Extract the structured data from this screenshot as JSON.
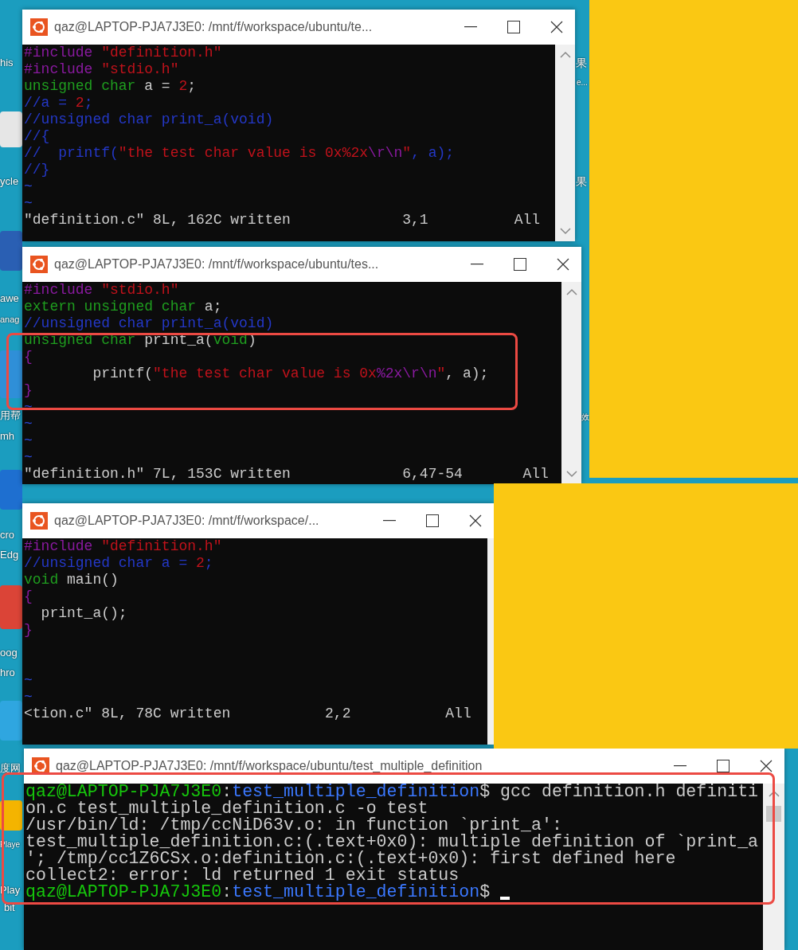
{
  "desktop": {
    "icon_labels": [
      {
        "text": "his"
      },
      {
        "text": "ycle"
      },
      {
        "text": "awe"
      },
      {
        "text": "anag"
      },
      {
        "text": "用帮"
      },
      {
        "text": "mh"
      },
      {
        "text": "cro"
      },
      {
        "text": "Edg"
      },
      {
        "text": "oog"
      },
      {
        "text": "hro"
      },
      {
        "text": "度网"
      },
      {
        "text": "Playe"
      },
      {
        "text": "Play"
      },
      {
        "text": "bit"
      },
      {
        "text": "果"
      },
      {
        "text": "e..."
      },
      {
        "text": "果"
      },
      {
        "text": "效"
      }
    ]
  },
  "windows": [
    {
      "kind": "vim",
      "title": "qaz@LAPTOP-PJA7J3E0: /mnt/f/workspace/ubuntu/te...",
      "lines": [
        [
          {
            "kind": "preproc",
            "text": "#include "
          },
          {
            "kind": "string",
            "text": "\"definition.h\""
          }
        ],
        [
          {
            "kind": "preproc",
            "text": "#include "
          },
          {
            "kind": "string",
            "text": "\"stdio.h\""
          }
        ],
        [
          {
            "kind": "type",
            "text": "unsigned char"
          },
          {
            "kind": "plain",
            "text": " a = "
          },
          {
            "kind": "number",
            "text": "2"
          },
          {
            "kind": "plain",
            "text": ";"
          }
        ],
        [
          {
            "kind": "comment",
            "text": "//a = "
          },
          {
            "kind": "number",
            "text": "2"
          },
          {
            "kind": "comment",
            "text": ";"
          }
        ],
        [
          {
            "kind": "comment",
            "text": "//unsigned char print_a(void)"
          }
        ],
        [
          {
            "kind": "comment",
            "text": "//{"
          }
        ],
        [
          {
            "kind": "comment",
            "text": "//  printf("
          },
          {
            "kind": "string",
            "text": "\"the test char value is 0x%2x"
          },
          {
            "kind": "special",
            "text": "\\r\\n"
          },
          {
            "kind": "string",
            "text": "\""
          },
          {
            "kind": "comment",
            "text": ", a);"
          }
        ],
        [
          {
            "kind": "comment",
            "text": "//}"
          }
        ],
        [
          {
            "kind": "tilde",
            "text": "~"
          }
        ],
        [
          {
            "kind": "tilde",
            "text": "~"
          }
        ]
      ],
      "status": {
        "message": "\"definition.c\" 8L, 162C written",
        "ruler": "3,1",
        "scope": "All"
      }
    },
    {
      "kind": "vim",
      "title": "qaz@LAPTOP-PJA7J3E0: /mnt/f/workspace/ubuntu/tes...",
      "lines": [
        [
          {
            "kind": "preproc",
            "text": "#include "
          },
          {
            "kind": "string",
            "text": "\"stdio.h\""
          }
        ],
        [
          {
            "kind": "type",
            "text": "extern unsigned char"
          },
          {
            "kind": "plain",
            "text": " a;"
          }
        ],
        [
          {
            "kind": "comment",
            "text": "//unsigned char print_a(void)"
          }
        ],
        [
          {
            "kind": "type",
            "text": "unsigned char"
          },
          {
            "kind": "plain",
            "text": " print_a("
          },
          {
            "kind": "type",
            "text": "void"
          },
          {
            "kind": "plain",
            "text": ")"
          }
        ],
        [
          {
            "kind": "preproc",
            "text": "{"
          }
        ],
        [
          {
            "kind": "plain",
            "text": "        printf("
          },
          {
            "kind": "string",
            "text": "\"the test char value is 0x"
          },
          {
            "kind": "special",
            "text": "%2x\\r\\n"
          },
          {
            "kind": "string",
            "text": "\""
          },
          {
            "kind": "plain",
            "text": ", a);"
          }
        ],
        [
          {
            "kind": "preproc",
            "text": "}"
          }
        ],
        [
          {
            "kind": "tilde",
            "text": "~"
          }
        ],
        [
          {
            "kind": "tilde",
            "text": "~"
          }
        ],
        [
          {
            "kind": "tilde",
            "text": "~"
          }
        ],
        [
          {
            "kind": "tilde",
            "text": "~"
          }
        ]
      ],
      "status": {
        "message": "\"definition.h\" 7L, 153C written",
        "ruler": "6,47-54",
        "scope": "All"
      }
    },
    {
      "kind": "vim",
      "title": "qaz@LAPTOP-PJA7J3E0: /mnt/f/workspace/...",
      "lines": [
        [
          {
            "kind": "preproc",
            "text": "#include "
          },
          {
            "kind": "string",
            "text": "\"definition.h\""
          }
        ],
        [
          {
            "kind": "comment",
            "text": "//unsigned char a = "
          },
          {
            "kind": "number",
            "text": "2"
          },
          {
            "kind": "comment",
            "text": ";"
          }
        ],
        [
          {
            "kind": "type",
            "text": "void"
          },
          {
            "kind": "plain",
            "text": " main()"
          }
        ],
        [
          {
            "kind": "preproc",
            "text": "{"
          }
        ],
        [
          {
            "kind": "plain",
            "text": "  print_a();"
          }
        ],
        [
          {
            "kind": "preproc",
            "text": "}"
          }
        ],
        [
          {
            "kind": "blank"
          }
        ],
        [
          {
            "kind": "blank"
          }
        ],
        [
          {
            "kind": "tilde",
            "text": "~"
          }
        ],
        [
          {
            "kind": "tilde",
            "text": "~"
          }
        ]
      ],
      "status": {
        "message": "<tion.c\" 8L, 78C written",
        "ruler": "2,2",
        "scope": "All"
      }
    },
    {
      "kind": "terminal",
      "title": "qaz@LAPTOP-PJA7J3E0: /mnt/f/workspace/ubuntu/test_multiple_definition",
      "lines": [
        [
          {
            "kind": "user",
            "text": "qaz@LAPTOP-PJA7J3E0"
          },
          {
            "kind": "plain",
            "text": ":"
          },
          {
            "kind": "path",
            "text": "test_multiple_definition"
          },
          {
            "kind": "plain",
            "text": "$ gcc definition.h definiti"
          }
        ],
        [
          {
            "kind": "plain",
            "text": "on.c test_multiple_definition.c -o test"
          }
        ],
        [
          {
            "kind": "plain",
            "text": "/usr/bin/ld: /tmp/ccNiD63v.o: in function `print_a':"
          }
        ],
        [
          {
            "kind": "plain",
            "text": "test_multiple_definition.c:(.text+0x0): multiple definition of `print_a"
          }
        ],
        [
          {
            "kind": "plain",
            "text": "'; /tmp/cc1Z6CSx.o:definition.c:(.text+0x0): first defined here"
          }
        ],
        [
          {
            "kind": "plain",
            "text": "collect2: error: ld returned 1 exit status"
          }
        ],
        [
          {
            "kind": "user",
            "text": "qaz@LAPTOP-PJA7J3E0"
          },
          {
            "kind": "plain",
            "text": ":"
          },
          {
            "kind": "path",
            "text": "test_multiple_definition"
          },
          {
            "kind": "plain",
            "text": "$ "
          },
          {
            "kind": "cursor"
          }
        ]
      ]
    }
  ]
}
